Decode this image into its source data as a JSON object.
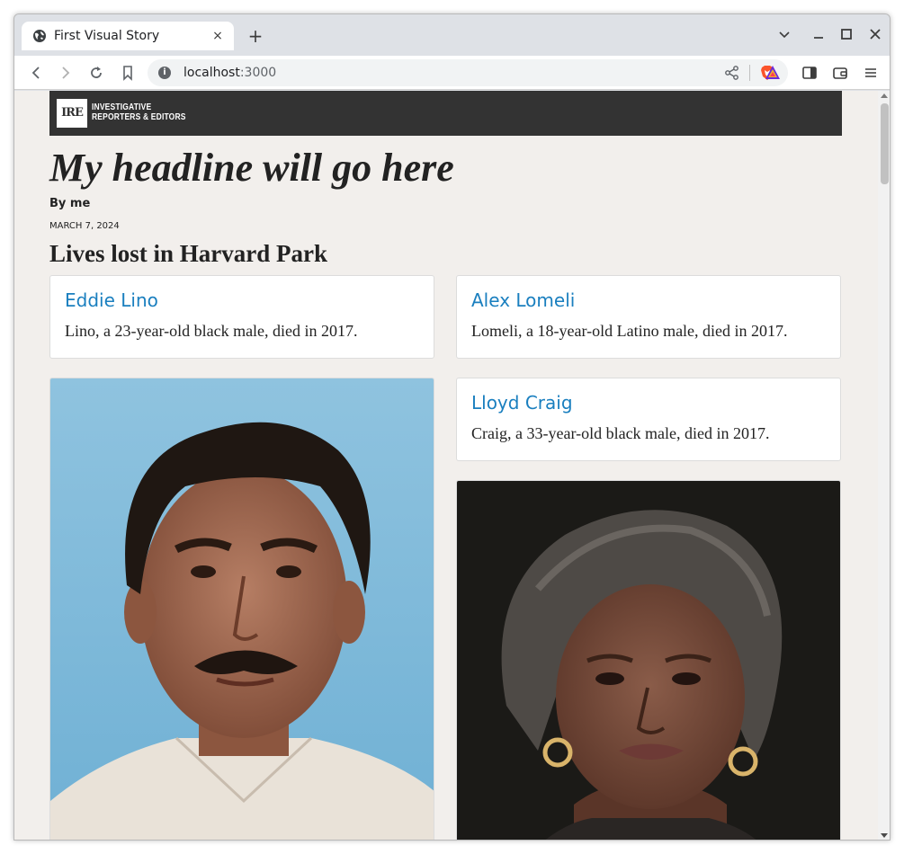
{
  "browser": {
    "tab_title": "First Visual Story",
    "tab_close": "×",
    "new_tab": "+",
    "url_host": "localhost",
    "url_port": ":3000"
  },
  "page": {
    "logo_mark": "IRE",
    "logo_line1": "INVESTIGATIVE",
    "logo_line2": "REPORTERS & EDITORS",
    "headline": "My headline will go here",
    "byline": "By me",
    "date": "MARCH 7, 2024",
    "section_title": "Lives lost in Harvard Park",
    "cards": [
      {
        "name": "Eddie Lino",
        "desc": "Lino, a 23-year-old black male, died in 2017."
      },
      {
        "name": "Alex Lomeli",
        "desc": "Lomeli, a 18-year-old Latino male, died in 2017."
      },
      {
        "name": "Lloyd Craig",
        "desc": "Craig, a 33-year-old black male, died in 2017."
      }
    ]
  },
  "colors": {
    "link_blue": "#1a7fbf",
    "page_bg": "#f2efec",
    "header_bg": "#333333"
  }
}
